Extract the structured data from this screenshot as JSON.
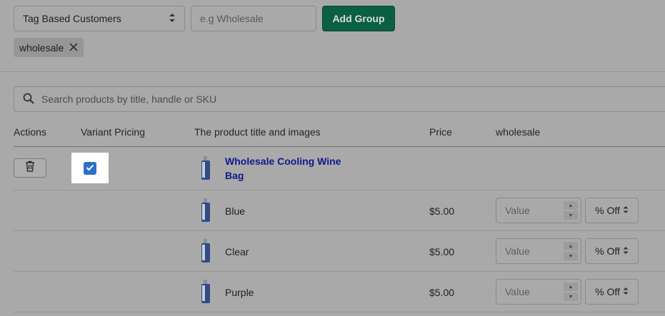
{
  "group": {
    "select_value": "Tag Based Customers",
    "input_placeholder": "e.g Wholesale",
    "add_label": "Add Group",
    "tag": "wholesale"
  },
  "search": {
    "placeholder": "Search products by title, handle or SKU"
  },
  "table": {
    "headers": [
      "Actions",
      "Variant Pricing",
      "The product title and images",
      "Price",
      "wholesale"
    ],
    "product": {
      "title": "Wholesale Cooling Wine Bag",
      "variant_pricing_checked": true
    },
    "variants": [
      {
        "name": "Blue",
        "price": "$5.00",
        "value_placeholder": "Value",
        "unit": "% Off"
      },
      {
        "name": "Clear",
        "price": "$5.00",
        "value_placeholder": "Value",
        "unit": "% Off"
      },
      {
        "name": "Purple",
        "price": "$5.00",
        "value_placeholder": "Value",
        "unit": "% Off"
      }
    ]
  },
  "colors": {
    "accent": "#0b5f42",
    "link": "#101a8c",
    "checkbox": "#2c6ecb"
  }
}
